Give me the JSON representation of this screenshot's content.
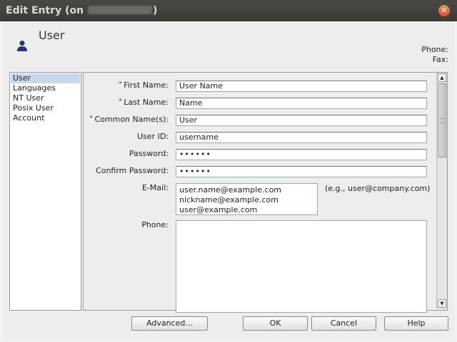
{
  "window": {
    "title_prefix": "Edit Entry (on ",
    "title_suffix": ")"
  },
  "header": {
    "title": "User",
    "phone_label": "Phone:",
    "fax_label": "Fax:"
  },
  "nav": {
    "items": [
      {
        "label": "User"
      },
      {
        "label": "Languages"
      },
      {
        "label": "NT User"
      },
      {
        "label": "Posix User"
      },
      {
        "label": "Account"
      }
    ]
  },
  "form": {
    "first_name_label": "First Name:",
    "first_name_value": "User Name",
    "last_name_label": "Last Name:",
    "last_name_value": "Name",
    "common_name_label": "Common Name(s):",
    "common_name_value": "User",
    "user_id_label": "User ID:",
    "user_id_value": "username",
    "password_label": "Password:",
    "password_value": "••••••",
    "confirm_password_label": "Confirm Password:",
    "confirm_password_value": "••••••",
    "email_label": "E-Mail:",
    "emails": [
      "user.name@example.com",
      "nickname@example.com",
      "user@example.com"
    ],
    "email_hint": "(e.g., user@company.com)",
    "phone_label": "Phone:",
    "required_marker": "*"
  },
  "buttons": {
    "advanced": "Advanced...",
    "ok": "OK",
    "cancel": "Cancel",
    "help": "Help"
  },
  "icons": {
    "close": "close-icon",
    "user": "user-icon"
  },
  "colors": {
    "titlebar": "#3c3b37",
    "close": "#e0603a",
    "selection": "#c9d7ea"
  }
}
